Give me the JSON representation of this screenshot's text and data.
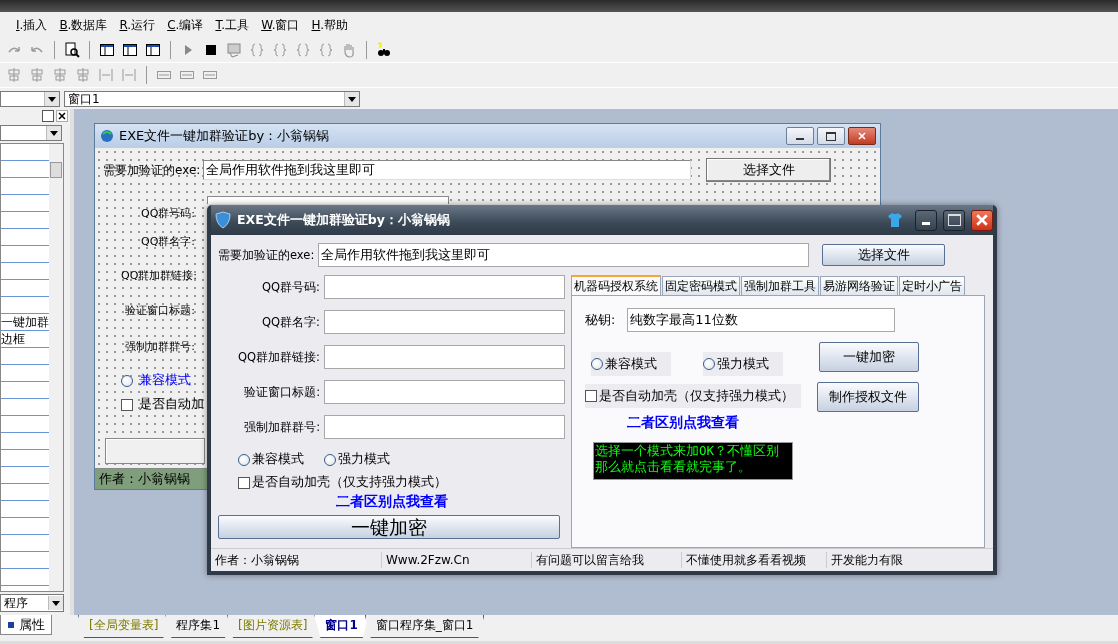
{
  "menu": [
    {
      "key": "I",
      "label": ".插入"
    },
    {
      "key": "B",
      "label": ".数据库"
    },
    {
      "key": "R",
      "label": ".运行"
    },
    {
      "key": "C",
      "label": ".编译"
    },
    {
      "key": "T",
      "label": ".工具"
    },
    {
      "key": "W",
      "label": ".窗口"
    },
    {
      "key": "H",
      "label": ".帮助"
    }
  ],
  "window_combo": {
    "value": "窗口1"
  },
  "left_panel": {
    "property_rows": [
      "一键加群",
      "边框"
    ],
    "bottom_combo": {
      "value": "程序"
    },
    "tab": {
      "label": "属性",
      "selected": true
    }
  },
  "design_window": {
    "title": "EXE文件一键加群验证by：小翁锅锅",
    "exe_label": "需要加验证的exe:",
    "exe_value": "全局作用软件拖到我这里即可",
    "choose_button": "选择文件",
    "labels": [
      "QQ群号码:",
      "QQ群名字:",
      "QQ群加群链接:",
      "验证窗口标题:",
      "强制加群群号:"
    ],
    "radio": {
      "label": "兼容模式",
      "checked": false
    },
    "checkbox": {
      "label": "是否自动加",
      "checked": false
    },
    "status": "作者：小翁锅锅"
  },
  "app_window": {
    "title": "EXE文件一键加群验证by：小翁锅锅",
    "exe_label": "需要加验证的exe:",
    "exe_value": "全局作用软件拖到我这里即可",
    "choose_button": "选择文件",
    "fields": [
      {
        "label": "QQ群号码:"
      },
      {
        "label": "QQ群名字:"
      },
      {
        "label": "QQ群加群链接:"
      },
      {
        "label": "验证窗口标题:"
      },
      {
        "label": "强制加群群号:"
      }
    ],
    "radios": [
      {
        "label": "兼容模式",
        "checked": false
      },
      {
        "label": "强力模式",
        "checked": false
      }
    ],
    "checkbox": {
      "label": "是否自动加壳（仅支持强力模式）",
      "checked": false
    },
    "link": "二者区别点我查看",
    "encrypt_button": "一键加密",
    "tabs": [
      {
        "label": "机器码授权系统",
        "selected": true
      },
      {
        "label": "固定密码模式",
        "selected": false
      },
      {
        "label": "强制加群工具",
        "selected": false
      },
      {
        "label": "易游网络验证",
        "selected": false
      },
      {
        "label": "定时小广告",
        "selected": false
      }
    ],
    "tab_content": {
      "secret_label": "秘钥:",
      "secret_value": "纯数字最高11位数",
      "radios": [
        {
          "label": "兼容模式",
          "checked": false
        },
        {
          "label": "强力模式",
          "checked": false
        }
      ],
      "checkbox": {
        "label": "是否自动加壳（仅支持强力模式）",
        "checked": false
      },
      "buttons": [
        "一键加密",
        "制作授权文件"
      ],
      "link": "二者区别点我查看",
      "message": [
        "选择一个模式来加OK？不懂区别",
        "那么就点击看看就完事了。"
      ]
    },
    "status_bar": [
      "作者：小翁锅锅",
      "Www.2Fzw.Cn",
      "有问题可以留言给我",
      "不懂使用就多看看视频",
      "开发能力有限"
    ]
  },
  "editor_tabs": [
    {
      "label": "[全局变量表]",
      "kind": "table",
      "selected": false
    },
    {
      "label": "程序集1",
      "kind": "code",
      "selected": false
    },
    {
      "label": "[图片资源表]",
      "kind": "table",
      "selected": false
    },
    {
      "label": "窗口1",
      "kind": "code",
      "selected": true
    },
    {
      "label": "窗口程序集_窗口1",
      "kind": "code",
      "selected": false
    }
  ]
}
